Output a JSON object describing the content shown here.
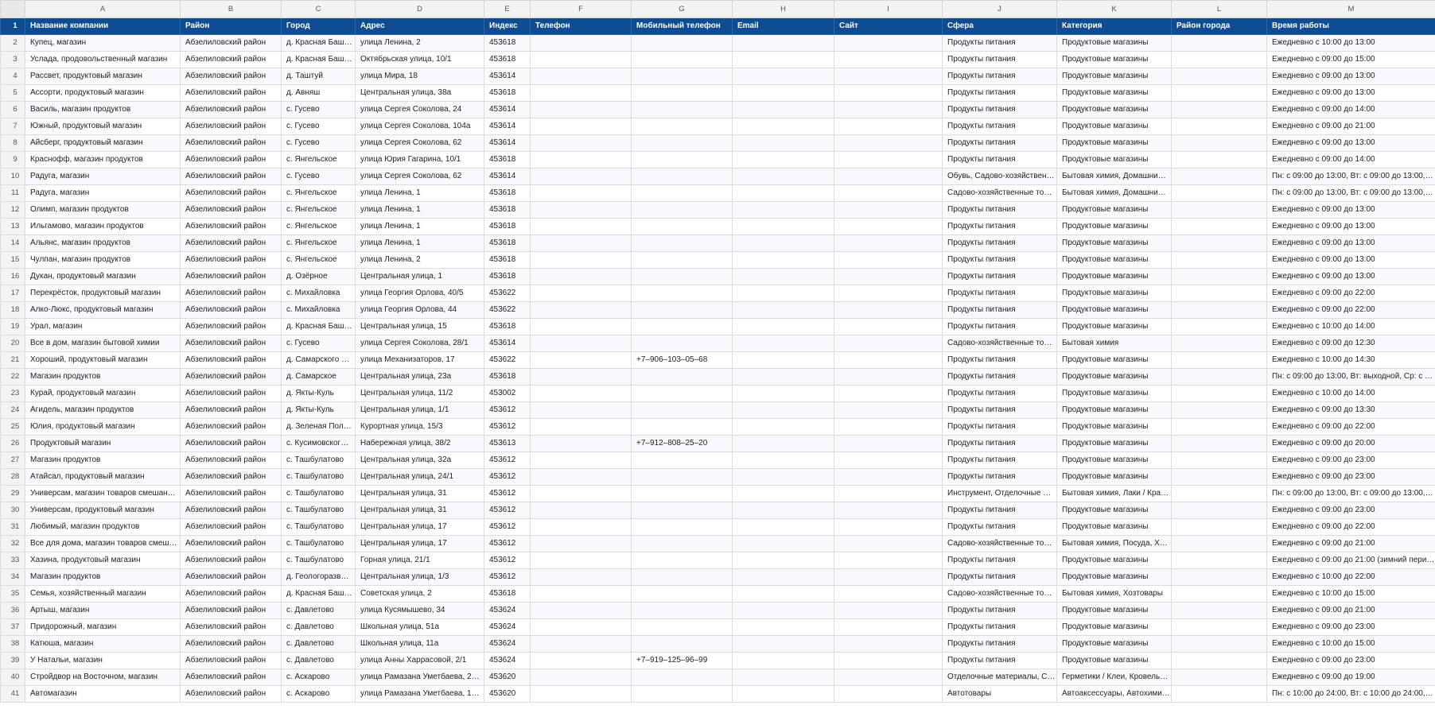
{
  "columns": [
    "A",
    "B",
    "C",
    "D",
    "E",
    "F",
    "G",
    "H",
    "I",
    "J",
    "K",
    "L",
    "M"
  ],
  "header": {
    "row": "1",
    "cells": [
      "Название компании",
      "Район",
      "Город",
      "Адрес",
      "Индекс",
      "Телефон",
      "Мобильный телефон",
      "Email",
      "Сайт",
      "Сфера",
      "Категория",
      "Район города",
      "Время работы"
    ]
  },
  "rows": [
    [
      "2",
      "Купец, магазин",
      "Абзелиловский район",
      "д. Красная Баш…",
      "улица Ленина, 2",
      "453618",
      "",
      "",
      "",
      "",
      "Продукты питания",
      "Продуктовые магазины",
      "",
      "Ежедневно с 10:00 до 13:00"
    ],
    [
      "3",
      "Услада, продовольственный магазин",
      "Абзелиловский район",
      "д. Красная Баш…",
      "Октябрьская улица, 10/1",
      "453618",
      "",
      "",
      "",
      "",
      "Продукты питания",
      "Продуктовые магазины",
      "",
      "Ежедневно с 09:00 до 15:00"
    ],
    [
      "4",
      "Рассвет, продуктовый магазин",
      "Абзелиловский район",
      "д. Таштуй",
      "улица Мира, 18",
      "453614",
      "",
      "",
      "",
      "",
      "Продукты питания",
      "Продуктовые магазины",
      "",
      "Ежедневно с 09:00 до 13:00"
    ],
    [
      "5",
      "Ассорти, продуктовый магазин",
      "Абзелиловский район",
      "д. Авняш",
      "Центральная улица, 38а",
      "453618",
      "",
      "",
      "",
      "",
      "Продукты питания",
      "Продуктовые магазины",
      "",
      "Ежедневно с 09:00 до 13:00"
    ],
    [
      "6",
      "Василь, магазин продуктов",
      "Абзелиловский район",
      "с. Гусево",
      "улица Сергея Соколова, 24",
      "453614",
      "",
      "",
      "",
      "",
      "Продукты питания",
      "Продуктовые магазины",
      "",
      "Ежедневно с 09:00 до 14:00"
    ],
    [
      "7",
      "Южный, продуктовый магазин",
      "Абзелиловский район",
      "с. Гусево",
      "улица Сергея Соколова, 104а",
      "453614",
      "",
      "",
      "",
      "",
      "Продукты питания",
      "Продуктовые магазины",
      "",
      "Ежедневно с 09:00 до 21:00"
    ],
    [
      "8",
      "Айсберг, продуктовый магазин",
      "Абзелиловский район",
      "с. Гусево",
      "улица Сергея Соколова, 62",
      "453614",
      "",
      "",
      "",
      "",
      "Продукты питания",
      "Продуктовые магазины",
      "",
      "Ежедневно с 09:00 до 13:00"
    ],
    [
      "9",
      "Краснофф, магазин продуктов",
      "Абзелиловский район",
      "с. Янгельское",
      "улица Юрия Гагарина, 10/1",
      "453618",
      "",
      "",
      "",
      "",
      "Продукты питания",
      "Продуктовые магазины",
      "",
      "Ежедневно с 09:00 до 14:00"
    ],
    [
      "10",
      "Радуга, магазин",
      "Абзелиловский район",
      "с. Гусево",
      "улица Сергея Соколова, 62",
      "453614",
      "",
      "",
      "",
      "",
      "Обувь, Садово-хозяйственн…",
      "Бытовая химия, Домашни…",
      "",
      "Пн: с 09:00 до 13:00, Вт: с 09:00 до 13:00, С…"
    ],
    [
      "11",
      "Радуга, магазин",
      "Абзелиловский район",
      "с. Янгельское",
      "улица Ленина, 1",
      "453618",
      "",
      "",
      "",
      "",
      "Садово-хозяйственные то…",
      "Бытовая химия, Домашни…",
      "",
      "Пн: с 09:00 до 13:00, Вт: с 09:00 до 13:00, С…"
    ],
    [
      "12",
      "Олимп, магазин продуктов",
      "Абзелиловский район",
      "с. Янгельское",
      "улица Ленина, 1",
      "453618",
      "",
      "",
      "",
      "",
      "Продукты питания",
      "Продуктовые магазины",
      "",
      "Ежедневно с 09:00 до 13:00"
    ],
    [
      "13",
      "Ильгамово, магазин продуктов",
      "Абзелиловский район",
      "с. Янгельское",
      "улица Ленина, 1",
      "453618",
      "",
      "",
      "",
      "",
      "Продукты питания",
      "Продуктовые магазины",
      "",
      "Ежедневно с 09:00 до 13:00"
    ],
    [
      "14",
      "Альянс, магазин продуктов",
      "Абзелиловский район",
      "с. Янгельское",
      "улица Ленина, 1",
      "453618",
      "",
      "",
      "",
      "",
      "Продукты питания",
      "Продуктовые магазины",
      "",
      "Ежедневно с 09:00 до 13:00"
    ],
    [
      "15",
      "Чулпан, магазин продуктов",
      "Абзелиловский район",
      "с. Янгельское",
      "улица Ленина, 2",
      "453618",
      "",
      "",
      "",
      "",
      "Продукты питания",
      "Продуктовые магазины",
      "",
      "Ежедневно с 09:00 до 13:00"
    ],
    [
      "16",
      "Дукан, продуктовый магазин",
      "Абзелиловский район",
      "д. Озёрное",
      "Центральная улица, 1",
      "453618",
      "",
      "",
      "",
      "",
      "Продукты питания",
      "Продуктовые магазины",
      "",
      "Ежедневно с 09:00 до 13:00"
    ],
    [
      "17",
      "Перекрёсток, продуктовый магазин",
      "Абзелиловский район",
      "с. Михайловка",
      "улица Георгия Орлова, 40/5",
      "453622",
      "",
      "",
      "",
      "",
      "Продукты питания",
      "Продуктовые магазины",
      "",
      "Ежедневно с 09:00 до 22:00"
    ],
    [
      "18",
      "Алко-Люкс, продуктовый магазин",
      "Абзелиловский район",
      "с. Михайловка",
      "улица Георгия Орлова, 44",
      "453622",
      "",
      "",
      "",
      "",
      "Продукты питания",
      "Продуктовые магазины",
      "",
      "Ежедневно с 09:00 до 22:00"
    ],
    [
      "19",
      "Урал, магазин",
      "Абзелиловский район",
      "д. Красная Баш…",
      "Центральная улица, 15",
      "453618",
      "",
      "",
      "",
      "",
      "Продукты питания",
      "Продуктовые магазины",
      "",
      "Ежедневно с 10:00 до 14:00"
    ],
    [
      "20",
      "Все в дом, магазин бытовой химии",
      "Абзелиловский район",
      "с. Гусево",
      "улица Сергея Соколова, 28/1",
      "453614",
      "",
      "",
      "",
      "",
      "Садово-хозяйственные то…",
      "Бытовая химия",
      "",
      "Ежедневно с 09:00 до 12:30"
    ],
    [
      "21",
      "Хороший, продуктовый магазин",
      "Абзелиловский район",
      "д. Самарского …",
      "улица Механизаторов, 17",
      "453622",
      "",
      "+7–906–103–05–68",
      "",
      "",
      "Продукты питания",
      "Продуктовые магазины",
      "",
      "Ежедневно с 10:00 до 14:30"
    ],
    [
      "22",
      "Магазин продуктов",
      "Абзелиловский район",
      "д. Самарское",
      "Центральная улица, 23а",
      "453618",
      "",
      "",
      "",
      "",
      "Продукты питания",
      "Продуктовые магазины",
      "",
      "Пн: с 09:00 до 13:00, Вт: выходной, Ср: с 0…"
    ],
    [
      "23",
      "Курай, продуктовый магазин",
      "Абзелиловский район",
      "д. Якты-Куль",
      "Центральная улица, 11/2",
      "453002",
      "",
      "",
      "",
      "",
      "Продукты питания",
      "Продуктовые магазины",
      "",
      "Ежедневно с 10:00 до 14:00"
    ],
    [
      "24",
      "Агидель, магазин продуктов",
      "Абзелиловский район",
      "д. Якты-Куль",
      "Центральная улица, 1/1",
      "453612",
      "",
      "",
      "",
      "",
      "Продукты питания",
      "Продуктовые магазины",
      "",
      "Ежедневно с 09:00 до 13:30"
    ],
    [
      "25",
      "Юлия, продуктовый магазин",
      "Абзелиловский район",
      "д. Зеленая Пол…",
      "Курортная улица, 15/3",
      "453612",
      "",
      "",
      "",
      "",
      "Продукты питания",
      "Продуктовые магазины",
      "",
      "Ежедневно с 09:00 до 22:00"
    ],
    [
      "26",
      "Продуктовый магазин",
      "Абзелиловский район",
      "с. Кусимовског…",
      "Набережная улица, 38/2",
      "453613",
      "",
      "+7–912–808–25–20",
      "",
      "",
      "Продукты питания",
      "Продуктовые магазины",
      "",
      "Ежедневно с 09:00 до 20:00"
    ],
    [
      "27",
      "Магазин продуктов",
      "Абзелиловский район",
      "с. Ташбулатово",
      "Центральная улица, 32а",
      "453612",
      "",
      "",
      "",
      "",
      "Продукты питания",
      "Продуктовые магазины",
      "",
      "Ежедневно с 09:00 до 23:00"
    ],
    [
      "28",
      "Атайсал, продуктовый магазин",
      "Абзелиловский район",
      "с. Ташбулатово",
      "Центральная улица, 24/1",
      "453612",
      "",
      "",
      "",
      "",
      "Продукты питания",
      "Продуктовые магазины",
      "",
      "Ежедневно с 09:00 до 23:00"
    ],
    [
      "29",
      "Универсам, магазин товаров смешан…",
      "Абзелиловский район",
      "с. Ташбулатово",
      "Центральная улица, 31",
      "453612",
      "",
      "",
      "",
      "",
      "Инструмент, Отделочные …",
      "Бытовая химия, Лаки / Кра…",
      "",
      "Пн: с 09:00 до 13:00, Вт: с 09:00 до 13:00, С…"
    ],
    [
      "30",
      "Универсам, продуктовый магазин",
      "Абзелиловский район",
      "с. Ташбулатово",
      "Центральная улица, 31",
      "453612",
      "",
      "",
      "",
      "",
      "Продукты питания",
      "Продуктовые магазины",
      "",
      "Ежедневно с 09:00 до 23:00"
    ],
    [
      "31",
      "Любимый, магазин продуктов",
      "Абзелиловский район",
      "с. Ташбулатово",
      "Центральная улица, 17",
      "453612",
      "",
      "",
      "",
      "",
      "Продукты питания",
      "Продуктовые магазины",
      "",
      "Ежедневно с 09:00 до 22:00"
    ],
    [
      "32",
      "Все для дома, магазин товаров смеш…",
      "Абзелиловский район",
      "с. Ташбулатово",
      "Центральная улица, 17",
      "453612",
      "",
      "",
      "",
      "",
      "Садово-хозяйственные то…",
      "Бытовая химия, Посуда, Х…",
      "",
      "Ежедневно с 09:00 до 21:00"
    ],
    [
      "33",
      "Хазина, продуктовый магазин",
      "Абзелиловский район",
      "с. Ташбулатово",
      "Горная улица, 21/1",
      "453612",
      "",
      "",
      "",
      "",
      "Продукты питания",
      "Продуктовые магазины",
      "",
      "Ежедневно с 09:00 до 21:00 (зимний пери…"
    ],
    [
      "34",
      "Магазин продуктов",
      "Абзелиловский район",
      "д. Геологоразв…",
      "Центральная улица, 1/3",
      "453612",
      "",
      "",
      "",
      "",
      "Продукты питания",
      "Продуктовые магазины",
      "",
      "Ежедневно с 10:00 до 22:00"
    ],
    [
      "35",
      "Семья, хозяйственный магазин",
      "Абзелиловский район",
      "д. Красная Баш…",
      "Советская улица, 2",
      "453618",
      "",
      "",
      "",
      "",
      "Садово-хозяйственные то…",
      "Бытовая химия, Хозтовары",
      "",
      "Ежедневно с 10:00 до 15:00"
    ],
    [
      "36",
      "Артыш, магазин",
      "Абзелиловский район",
      "с. Давлетово",
      "улица Кусямышево, 34",
      "453624",
      "",
      "",
      "",
      "",
      "Продукты питания",
      "Продуктовые магазины",
      "",
      "Ежедневно с 09:00 до 21:00"
    ],
    [
      "37",
      "Придорожный, магазин",
      "Абзелиловский район",
      "с. Давлетово",
      "Школьная улица, 51а",
      "453624",
      "",
      "",
      "",
      "",
      "Продукты питания",
      "Продуктовые магазины",
      "",
      "Ежедневно с 09:00 до 23:00"
    ],
    [
      "38",
      "Катюша, магазин",
      "Абзелиловский район",
      "с. Давлетово",
      "Школьная улица, 11а",
      "453624",
      "",
      "",
      "",
      "",
      "Продукты питания",
      "Продуктовые магазины",
      "",
      "Ежедневно с 10:00 до 15:00"
    ],
    [
      "39",
      "У Натальи, магазин",
      "Абзелиловский район",
      "с. Давлетово",
      "улица Анны Харрасовой, 2/1",
      "453624",
      "",
      "+7–919–125–96–99",
      "",
      "",
      "Продукты питания",
      "Продуктовые магазины",
      "",
      "Ежедневно с 09:00 до 23:00"
    ],
    [
      "40",
      "Стройдвор на Восточном, магазин",
      "Абзелиловский район",
      "с. Аскарово",
      "улица Рамазана Уметбаева, 25…",
      "453620",
      "",
      "",
      "",
      "",
      "Отделочные материалы, С…",
      "Герметики / Клеи, Кровель…",
      "",
      "Ежедневно с 09:00 до 19:00"
    ],
    [
      "41",
      "Автомагазин",
      "Абзелиловский район",
      "с. Аскарово",
      "улица Рамазана Уметбаева, 10…",
      "453620",
      "",
      "",
      "",
      "",
      "Автотовары",
      "Автоаксессуары, Автохими…",
      "",
      "Пн: с 10:00 до 24:00, Вт: с 10:00 до 24:00, С…"
    ]
  ]
}
